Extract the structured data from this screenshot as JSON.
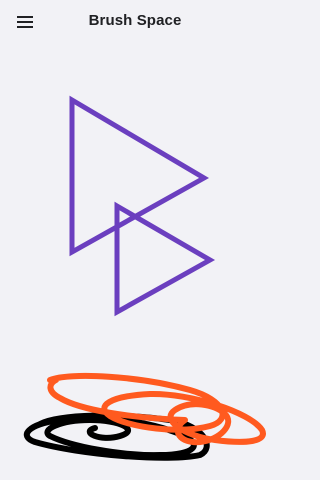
{
  "app": {
    "title": "Brush Space"
  },
  "toolbar": {
    "menu_icon": "hamburger-menu-icon"
  },
  "colors": {
    "background": "#f2f2f6",
    "stroke_purple": "#6b3fbf",
    "stroke_orange": "#ff5a1f",
    "stroke_black": "#000000",
    "title_text": "#202124"
  }
}
